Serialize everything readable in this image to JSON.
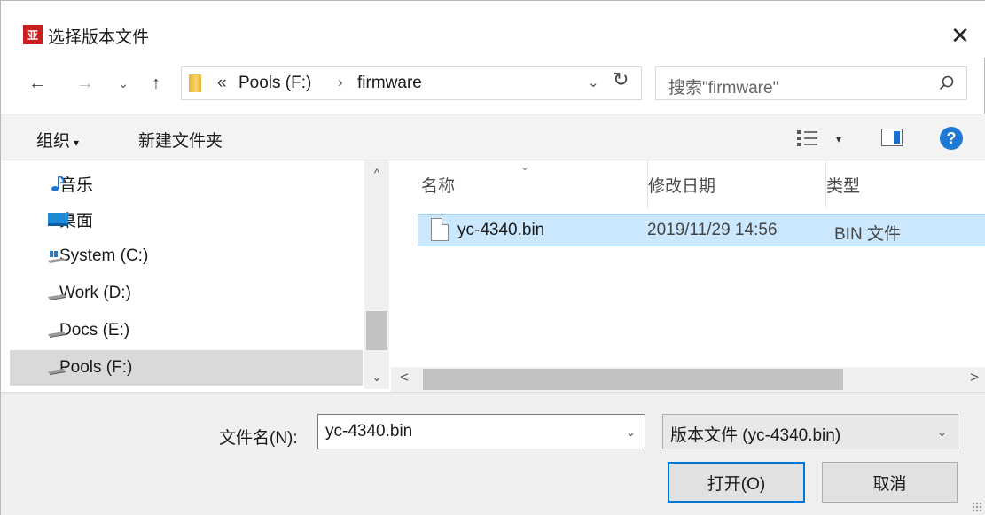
{
  "window": {
    "title": "选择版本文件",
    "app_icon_text": "亚",
    "close_glyph": "✕"
  },
  "navigation": {
    "back_glyph": "←",
    "forward_glyph": "→",
    "recent_glyph": "⌄",
    "up_glyph": "↑",
    "breadcrumb_prefix": "«",
    "breadcrumbs": [
      "Pools (F:)",
      "firmware"
    ],
    "breadcrumb_separator": "›",
    "dropdown_glyph": "⌄",
    "refresh_glyph": "↻"
  },
  "search": {
    "placeholder": "搜索\"firmware\""
  },
  "toolbar": {
    "organize_label": "组织",
    "organize_caret": "▾",
    "new_folder_label": "新建文件夹",
    "view_caret": "▾",
    "help_glyph": "?"
  },
  "nav_pane": {
    "items": [
      {
        "label": "音乐",
        "icon": "music-note-icon"
      },
      {
        "label": "桌面",
        "icon": "desktop-icon"
      },
      {
        "label": "System (C:)",
        "icon": "windows-drive-icon"
      },
      {
        "label": "Work (D:)",
        "icon": "drive-icon"
      },
      {
        "label": "Docs (E:)",
        "icon": "drive-icon"
      },
      {
        "label": "Pools (F:)",
        "icon": "drive-icon",
        "selected": true
      }
    ],
    "scroll_up_glyph": "^",
    "scroll_down_glyph": "⌄"
  },
  "file_list": {
    "columns": [
      "名称",
      "修改日期",
      "类型"
    ],
    "sort_caret": "⌄",
    "rows": [
      {
        "name": "yc-4340.bin",
        "modified": "2019/11/29 14:56",
        "type": "BIN 文件",
        "selected": true
      }
    ],
    "scroll_left_glyph": "<",
    "scroll_right_glyph": ">"
  },
  "footer": {
    "filename_label": "文件名(N):",
    "filename_value": "yc-4340.bin",
    "filename_caret": "⌄",
    "filetype_value": "版本文件  (yc-4340.bin)",
    "filetype_caret": "⌄",
    "open_label": "打开(O)",
    "cancel_label": "取消"
  },
  "colors": {
    "accent": "#0078d7",
    "selection_bg": "#cce8ff",
    "app_icon_bg": "#c81e1e",
    "help_bg": "#1e78d4"
  }
}
